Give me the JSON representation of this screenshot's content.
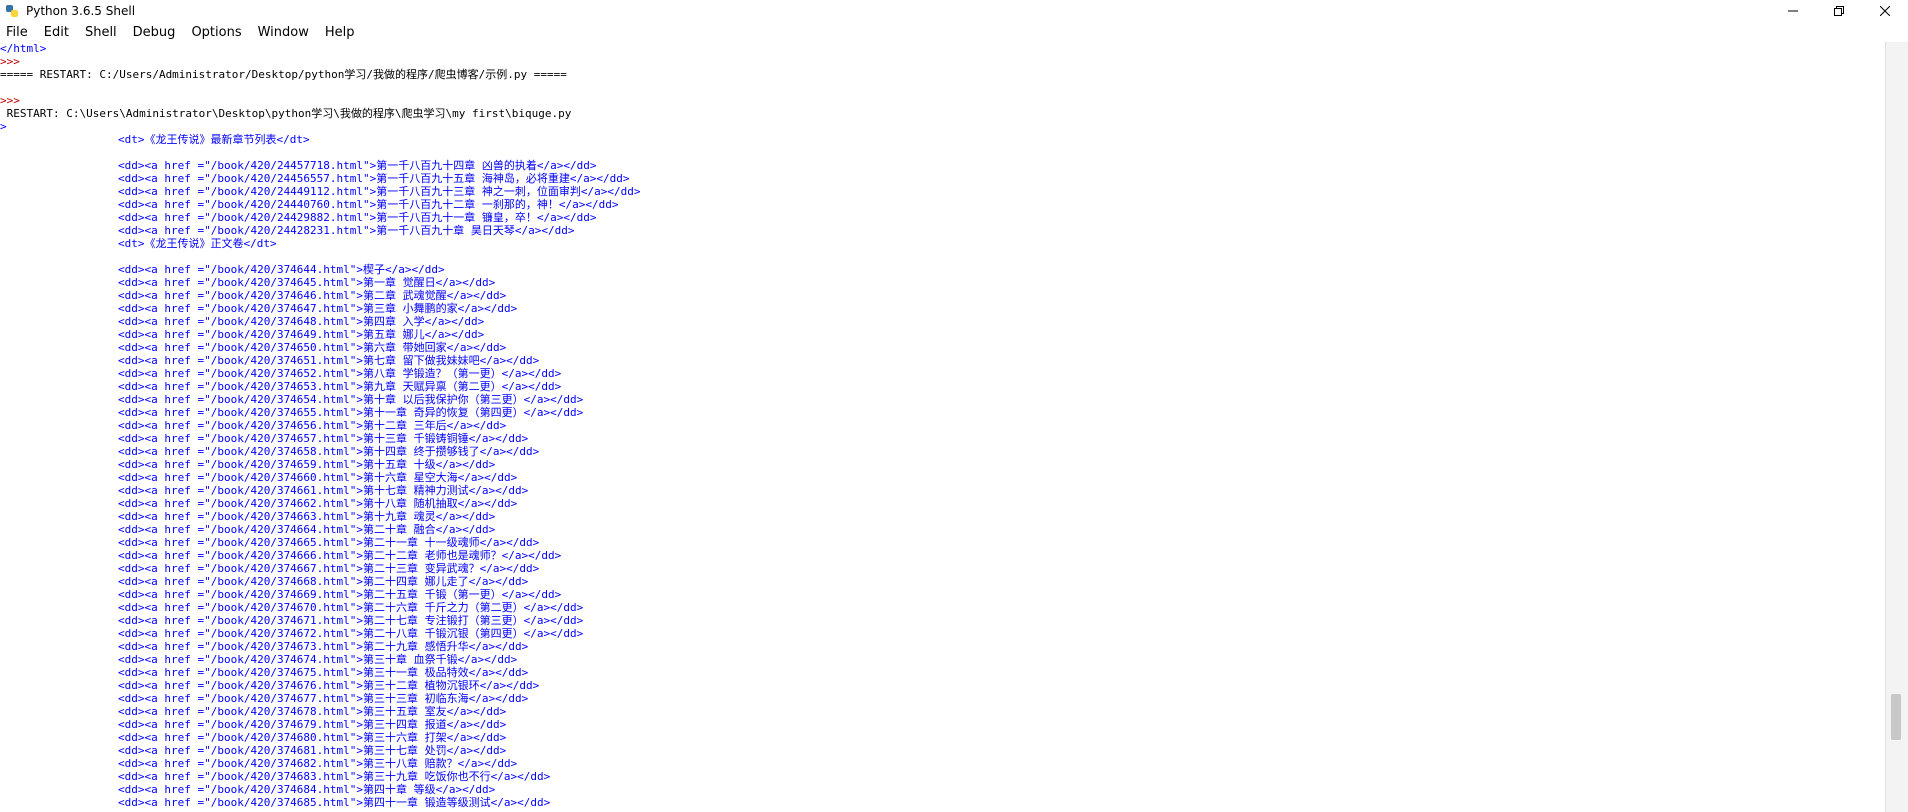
{
  "window": {
    "title": "Python 3.6.5 Shell",
    "icons": {
      "app": "python-icon",
      "minimize": "minimize-icon",
      "restore": "restore-icon",
      "close": "close-icon"
    }
  },
  "menu": [
    "File",
    "Edit",
    "Shell",
    "Debug",
    "Options",
    "Window",
    "Help"
  ],
  "shell": {
    "lines": [
      {
        "text": "</html>",
        "color": "blue"
      },
      {
        "text": ">>> ",
        "color": "prompt"
      },
      {
        "text": "===== RESTART: C:/Users/Administrator/Desktop/python学习/我做的程序/爬虫博客/示例.py =====",
        "color": "black"
      },
      {
        "text": "",
        "color": "black"
      },
      {
        "text": ">>> ",
        "color": "prompt"
      },
      {
        "text": " RESTART: C:\\Users\\Administrator\\Desktop\\python学习\\我做的程序\\爬虫学习\\my first\\biquge.py",
        "color": "black"
      },
      {
        "text": ">",
        "color": "blue"
      }
    ],
    "output": [
      "<dt>《龙王传说》最新章节列表</dt>",
      "",
      "<dd><a href =\"/book/420/24457718.html\">第一千八百九十四章 凶兽的执着</a></dd>",
      "<dd><a href =\"/book/420/24456557.html\">第一千八百九十五章 海神岛，必将重建</a></dd>",
      "<dd><a href =\"/book/420/24449112.html\">第一千八百九十三章 神之一刺，位面审判</a></dd>",
      "<dd><a href =\"/book/420/24440760.html\">第一千八百九十二章 一刹那的，神！</a></dd>",
      "<dd><a href =\"/book/420/24429882.html\">第一千八百九十一章 镰皇，卒！</a></dd>",
      "<dd><a href =\"/book/420/24428231.html\">第一千八百九十章 昊日天琴</a></dd>",
      "<dt>《龙王传说》正文卷</dt>",
      "",
      "<dd><a href =\"/book/420/374644.html\">楔子</a></dd>",
      "<dd><a href =\"/book/420/374645.html\">第一章 觉醒日</a></dd>",
      "<dd><a href =\"/book/420/374646.html\">第二章 武魂觉醒</a></dd>",
      "<dd><a href =\"/book/420/374647.html\">第三章 小舞鹏的家</a></dd>",
      "<dd><a href =\"/book/420/374648.html\">第四章 入学</a></dd>",
      "<dd><a href =\"/book/420/374649.html\">第五章 娜儿</a></dd>",
      "<dd><a href =\"/book/420/374650.html\">第六章 带她回家</a></dd>",
      "<dd><a href =\"/book/420/374651.html\">第七章 留下做我妹妹吧</a></dd>",
      "<dd><a href =\"/book/420/374652.html\">第八章 学锻造？（第一更）</a></dd>",
      "<dd><a href =\"/book/420/374653.html\">第九章 天赋异禀（第二更）</a></dd>",
      "<dd><a href =\"/book/420/374654.html\">第十章 以后我保护你（第三更）</a></dd>",
      "<dd><a href =\"/book/420/374655.html\">第十一章 奇异的恢复（第四更）</a></dd>",
      "<dd><a href =\"/book/420/374656.html\">第十二章 三年后</a></dd>",
      "<dd><a href =\"/book/420/374657.html\">第十三章 千锻铸铜锤</a></dd>",
      "<dd><a href =\"/book/420/374658.html\">第十四章 终于攒够钱了</a></dd>",
      "<dd><a href =\"/book/420/374659.html\">第十五章 十级</a></dd>",
      "<dd><a href =\"/book/420/374660.html\">第十六章 星空大海</a></dd>",
      "<dd><a href =\"/book/420/374661.html\">第十七章 精神力测试</a></dd>",
      "<dd><a href =\"/book/420/374662.html\">第十八章 随机抽取</a></dd>",
      "<dd><a href =\"/book/420/374663.html\">第十九章 魂灵</a></dd>",
      "<dd><a href =\"/book/420/374664.html\">第二十章 融合</a></dd>",
      "<dd><a href =\"/book/420/374665.html\">第二十一章 十一级魂师</a></dd>",
      "<dd><a href =\"/book/420/374666.html\">第二十二章 老师也是魂师？</a></dd>",
      "<dd><a href =\"/book/420/374667.html\">第二十三章 变异武魂？</a></dd>",
      "<dd><a href =\"/book/420/374668.html\">第二十四章 娜儿走了</a></dd>",
      "<dd><a href =\"/book/420/374669.html\">第二十五章 千锻（第一更）</a></dd>",
      "<dd><a href =\"/book/420/374670.html\">第二十六章 千斤之力（第二更）</a></dd>",
      "<dd><a href =\"/book/420/374671.html\">第二十七章 专注锻打（第三更）</a></dd>",
      "<dd><a href =\"/book/420/374672.html\">第二十八章 千锻沉银（第四更）</a></dd>",
      "<dd><a href =\"/book/420/374673.html\">第二十九章 感悟升华</a></dd>",
      "<dd><a href =\"/book/420/374674.html\">第三十章 血祭千锻</a></dd>",
      "<dd><a href =\"/book/420/374675.html\">第三十一章 极品特效</a></dd>",
      "<dd><a href =\"/book/420/374676.html\">第三十二章 植物沉银环</a></dd>",
      "<dd><a href =\"/book/420/374677.html\">第三十三章 初临东海</a></dd>",
      "<dd><a href =\"/book/420/374678.html\">第三十五章 室友</a></dd>",
      "<dd><a href =\"/book/420/374679.html\">第三十四章 报道</a></dd>",
      "<dd><a href =\"/book/420/374680.html\">第三十六章 打架</a></dd>",
      "<dd><a href =\"/book/420/374681.html\">第三十七章 处罚</a></dd>",
      "<dd><a href =\"/book/420/374682.html\">第三十八章 赔款？</a></dd>",
      "<dd><a href =\"/book/420/374683.html\">第三十九章 吃饭你也不行</a></dd>",
      "<dd><a href =\"/book/420/374684.html\">第四十章 等级</a></dd>",
      "<dd><a href =\"/book/420/374685.html\">第四十一章 锻造等级测试</a></dd>"
    ]
  }
}
